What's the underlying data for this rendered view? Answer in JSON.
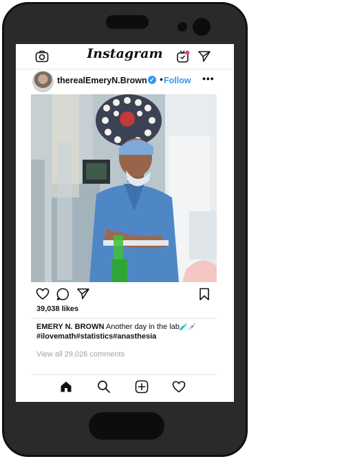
{
  "app": {
    "title": "Instagram"
  },
  "header": {
    "icons": [
      "camera-icon",
      "igtv-icon",
      "direct-message-icon"
    ]
  },
  "post": {
    "username": "therealEmeryN.Brown",
    "verified_glyph": "✓",
    "separator": "•",
    "follow_label": "Follow",
    "more_label": "•••",
    "likes": "39,038 likes",
    "caption_user": "EMERY N. BROWN",
    "caption_text": " Another day in the lab",
    "caption_emoji": "🧪💉",
    "hashtags": "#ilovemath#statistics#anasthesia",
    "comments_link": "View all 29,026 comments"
  },
  "actions": {
    "icons": [
      "heart-icon",
      "comment-icon",
      "share-icon",
      "bookmark-icon"
    ]
  },
  "bottom_nav": {
    "icons": [
      "home-icon",
      "search-icon",
      "add-post-icon",
      "activity-heart-icon"
    ]
  },
  "colors": {
    "accent": "#3897f0",
    "phone_body": "#2a2a2c",
    "muted_text": "#a0a0a0"
  }
}
